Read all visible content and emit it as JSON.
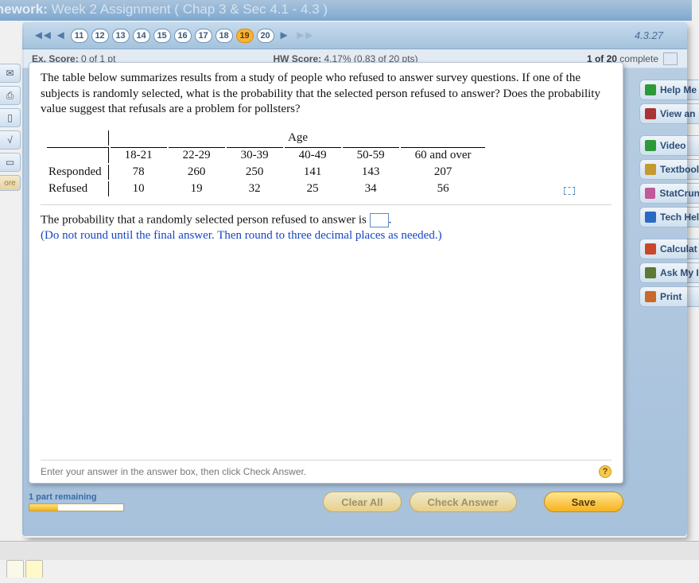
{
  "title": {
    "hw_label": "nework:",
    "name": "Week 2 Assignment ( Chap 3 & Sec 4.1 - 4.3 )"
  },
  "nav": {
    "pills": [
      "11",
      "12",
      "13",
      "14",
      "15",
      "16",
      "17",
      "18",
      "19",
      "20"
    ],
    "active_index": 8,
    "right_label": "4.3.27"
  },
  "scorebar": {
    "ex_label": "Ex. Score:",
    "ex_value": "0 of 1 pt",
    "hw_label": "HW Score:",
    "hw_value": "4.17% (0.83 of 20 pts)",
    "complete_n": "1 of 20",
    "complete_word": "complete"
  },
  "left_tabs": {
    "ore": "ore"
  },
  "question": {
    "text": "The table below summarizes results from a study of people who refused to answer survey questions. If one of the subjects is randomly selected, what is the probability that the selected person refused to answer? Does the probability value suggest that refusals are a problem for pollsters?",
    "age_header": "Age",
    "cols": [
      "18-21",
      "22-29",
      "30-39",
      "40-49",
      "50-59",
      "60 and over"
    ],
    "rows": [
      {
        "label": "Responded",
        "vals": [
          "78",
          "260",
          "250",
          "141",
          "143",
          "207"
        ]
      },
      {
        "label": "Refused",
        "vals": [
          "10",
          "19",
          "32",
          "25",
          "34",
          "56"
        ]
      }
    ],
    "prob_line_a": "The probability that a randomly selected person refused to answer is ",
    "prob_line_b": ".",
    "note": "(Do not round until the final answer. Then round to three decimal places as needed.)",
    "footer_hint": "Enter your answer in the answer box, then click Check Answer."
  },
  "side": {
    "items": [
      {
        "name": "help-me",
        "label": "Help Me",
        "color": "#2d9a3a"
      },
      {
        "name": "view-an",
        "label": "View an",
        "color": "#a33"
      },
      {
        "name": "video",
        "label": "Video",
        "color": "#2d9a3a"
      },
      {
        "name": "textbook",
        "label": "Textbool",
        "color": "#c49a2e"
      },
      {
        "name": "statcrunch",
        "label": "StatCrun",
        "color": "#c05a9a"
      },
      {
        "name": "tech-help",
        "label": "Tech Hel",
        "color": "#2a6ac4"
      },
      {
        "name": "calculator",
        "label": "Calculat",
        "color": "#c9462a"
      },
      {
        "name": "ask-instructor",
        "label": "Ask My I",
        "color": "#5a7a36"
      },
      {
        "name": "print",
        "label": "Print",
        "color": "#c9692a"
      }
    ]
  },
  "bottom": {
    "progress_label": "1 part remaining",
    "clear": "Clear All",
    "check": "Check Answer",
    "save": "Save"
  }
}
